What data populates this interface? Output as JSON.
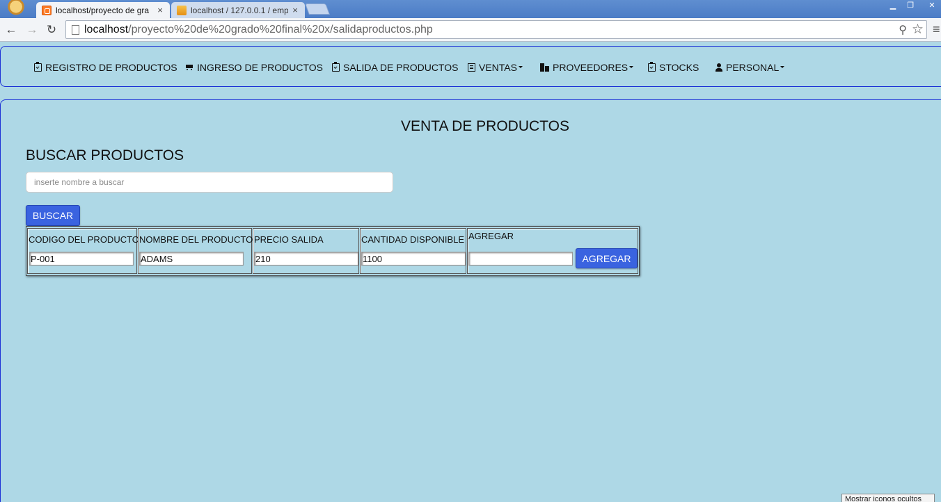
{
  "browser": {
    "tabs": [
      {
        "title": "localhost/proyecto de gra",
        "favicon": "xampp-icon",
        "active": true
      },
      {
        "title": "localhost / 127.0.0.1 / emp",
        "favicon": "phpmyadmin-icon",
        "active": false
      }
    ],
    "close_glyph": "×",
    "url_host": "localhost",
    "url_path": "/proyecto%20de%20grado%20final%20x/salidaproductos.php",
    "window_controls": {
      "minimize": "▁",
      "maximize": "❐",
      "close": "✕"
    },
    "nav": {
      "back": "←",
      "forward": "→",
      "reload": "↻"
    },
    "zoom_glyph": "⚲",
    "star_glyph": "☆",
    "menu_glyph": "≡"
  },
  "navbar": {
    "items": [
      {
        "label": "REGISTRO DE PRODUCTOS",
        "icon": "clipboard-check-icon",
        "dropdown": false
      },
      {
        "label": "INGRESO DE PRODUCTOS",
        "icon": "cart-icon",
        "dropdown": false
      },
      {
        "label": "SALIDA DE PRODUCTOS",
        "icon": "clipboard-check-icon",
        "dropdown": false
      },
      {
        "label": "VENTAS",
        "icon": "list-alt-icon",
        "dropdown": true
      },
      {
        "label": "PROVEEDORES",
        "icon": "building-icon",
        "dropdown": true
      },
      {
        "label": "STOCKS",
        "icon": "clipboard-check-icon",
        "dropdown": false
      },
      {
        "label": "PERSONAL",
        "icon": "user-icon",
        "dropdown": true
      }
    ]
  },
  "page": {
    "title": "VENTA DE PRODUCTOS",
    "search_title": "BUSCAR PRODUCTOS",
    "search_placeholder": "inserte nombre a buscar",
    "search_button": "BUSCAR"
  },
  "table": {
    "columns": [
      "CODIGO DEL PRODUCTO",
      "NOMBRE DEL PRODUCTO",
      "PRECIO SALIDA",
      "CANTIDAD DISPONIBLE",
      "AGREGAR"
    ],
    "row": {
      "codigo": "P-001",
      "nombre": "ADAMS",
      "precio": "210",
      "cantidad": "1100",
      "agregar": ""
    },
    "add_button": "AGREGAR"
  },
  "tooltip": "Mostrar iconos ocultos",
  "colors": {
    "page_background": "#aed8e6",
    "panel_border": "#1a2fd6",
    "button_blue": "#3a63e0",
    "tabstrip_blue": "#4b7cc6"
  }
}
